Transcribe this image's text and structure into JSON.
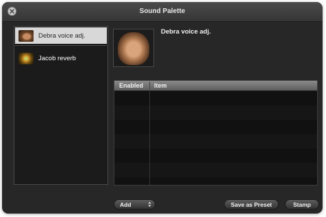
{
  "window": {
    "title": "Sound Palette"
  },
  "presets": [
    {
      "label": "Debra voice adj.",
      "icon": "face-thumbnail-icon",
      "selected": true
    },
    {
      "label": "Jacob reverb",
      "icon": "reverb-thumbnail-icon",
      "selected": false
    }
  ],
  "detail": {
    "preset_name": "Debra voice adj.",
    "image_icon": "face-photo-icon"
  },
  "effects_table": {
    "columns": [
      "Enabled",
      "Item"
    ],
    "rows": []
  },
  "footer": {
    "add_label": "Add",
    "save_preset_label": "Save as Preset",
    "stamp_label": "Stamp"
  },
  "colors": {
    "window_bg": "#272727",
    "selection_bg": "#d8d8d8",
    "table_bg": "#161616"
  }
}
